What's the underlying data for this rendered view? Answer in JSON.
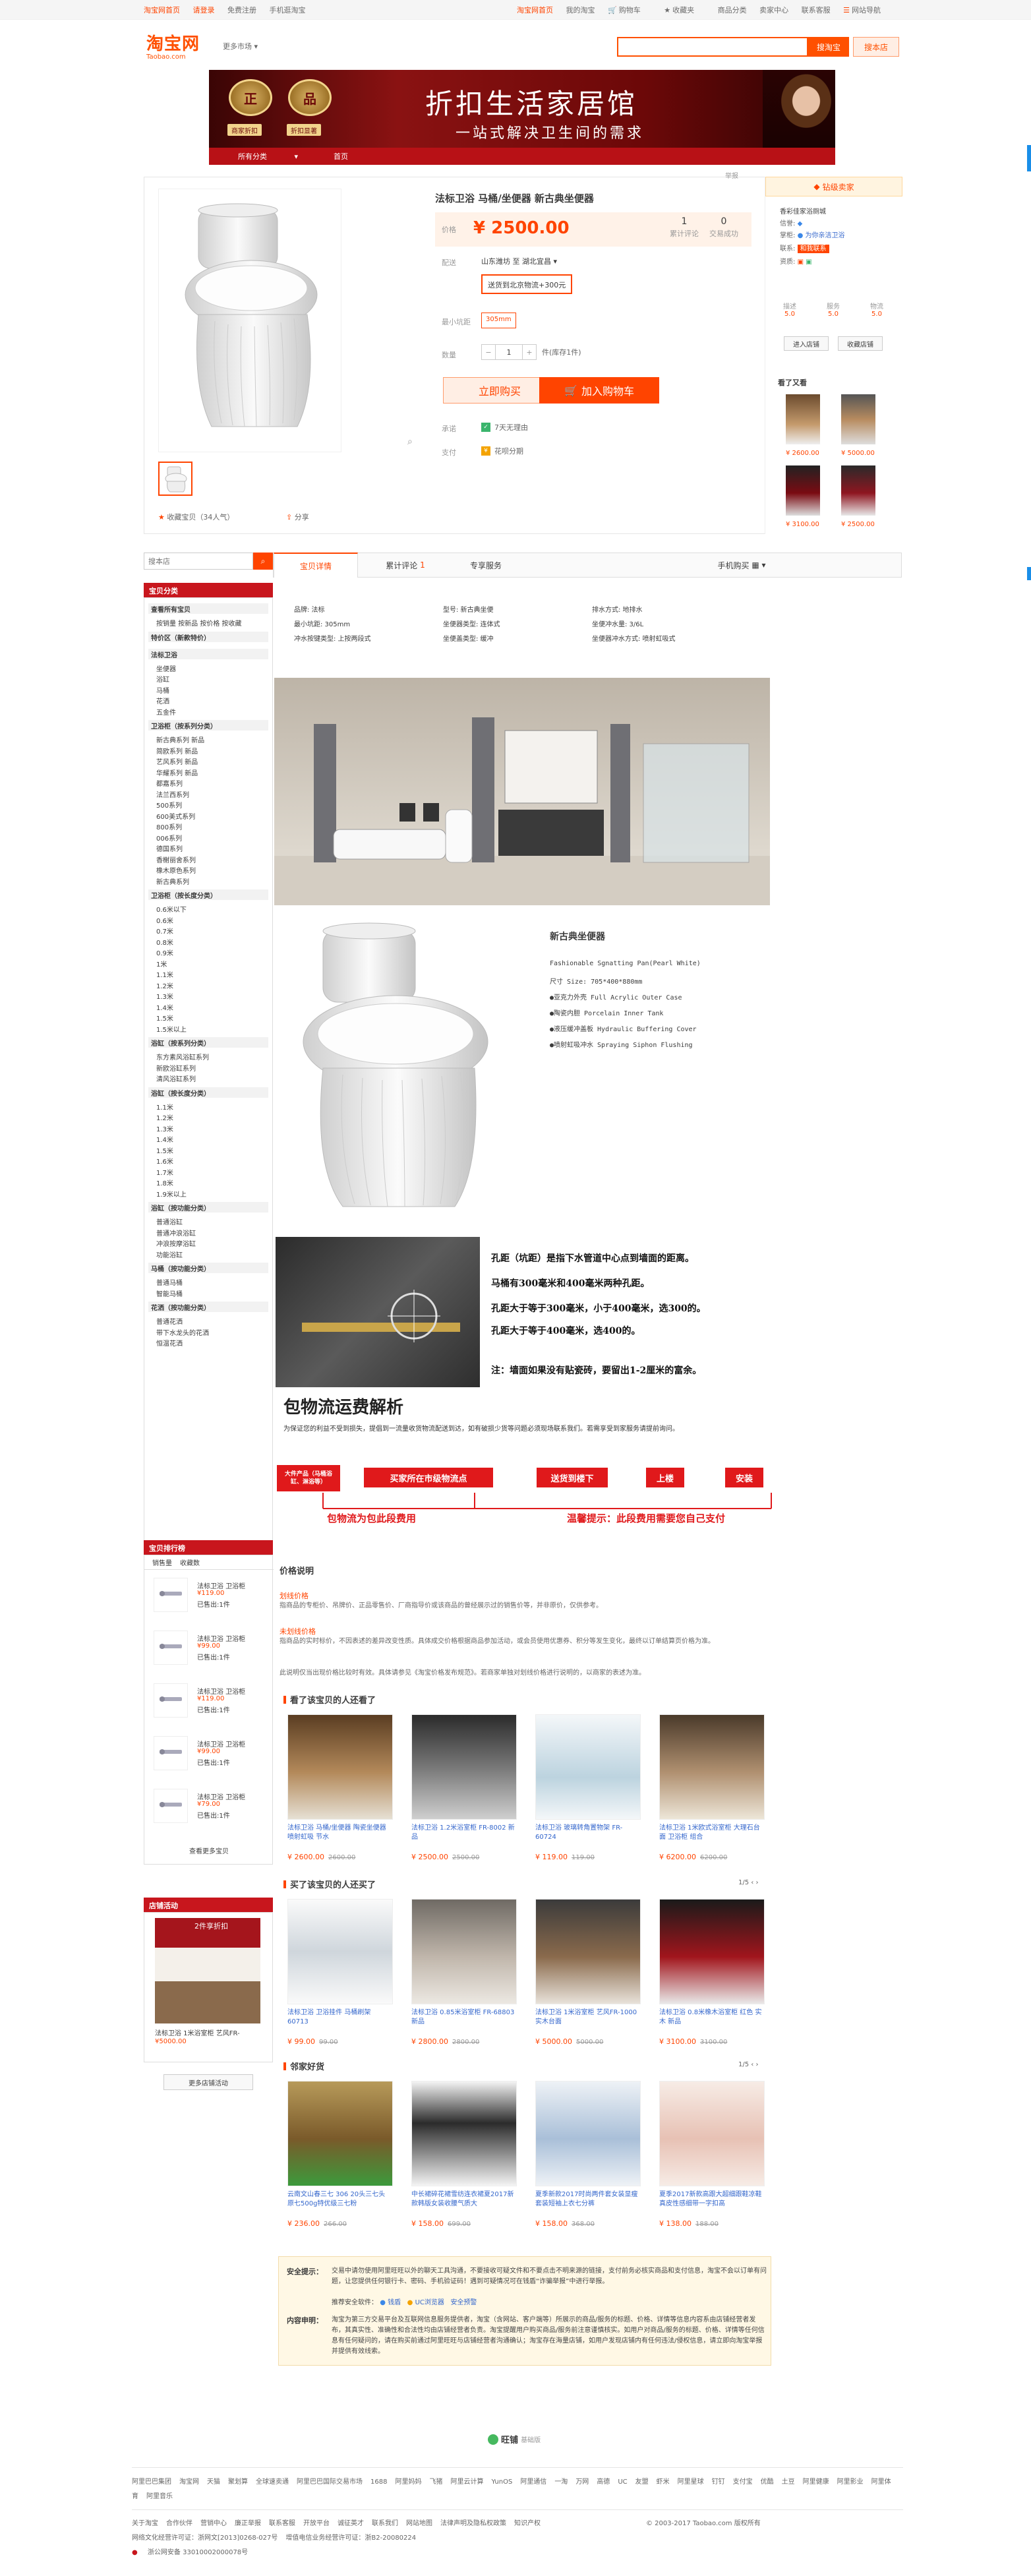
{
  "topnav": {
    "left": [
      "淘宝网首页",
      "请登录",
      "免费注册",
      "手机逛淘宝"
    ],
    "right": [
      "淘宝网首页",
      "我的淘宝",
      "购物车",
      "收藏夹",
      "商品分类",
      "卖家中心",
      "联系客服",
      "网站导航"
    ]
  },
  "header": {
    "logo_cn": "淘宝网",
    "logo_en": "Taobao.com",
    "market": "更多市场",
    "search_placeholder": "",
    "search_taobao": "搜淘宝",
    "search_shop": "搜本店"
  },
  "banner": {
    "title": "折扣生活家居馆",
    "subtitle": "一站式解决卫生间的需求",
    "seal_left": "正",
    "seal_right": "品",
    "mini_left": "商家折扣",
    "mini_right": "折扣显著"
  },
  "shopnav": [
    "所有分类",
    "首页"
  ],
  "product": {
    "title": "法标卫浴 马桶/坐便器 新古典坐便器",
    "price_label": "价格",
    "price": "¥ 2500.00",
    "review_count": "1",
    "review_label": "累计评论",
    "sales_count": "0",
    "sales_label": "交易成功",
    "delivery_label": "配送",
    "delivery_value": "山东潍坊 至 湖北宜昌 ▾",
    "sku_option": "送货到北京物流+300元",
    "size_label": "最小坑距",
    "size_value": "305mm",
    "qty_label": "数量",
    "qty_value": "1",
    "qty_unit": "件(库存1件)",
    "buy_now": "立即购买",
    "add_cart": "加入购物车",
    "promise_label": "承诺",
    "promise_value": "7天无理由",
    "pay_label": "支付",
    "pay_value": "花呗分期",
    "report": "举报",
    "fav_label": "收藏宝贝（34人气）",
    "share_label": "分享"
  },
  "shop": {
    "rank": "钻级卖家",
    "name": "香彩佳家浴厕城",
    "credit_label": "信誉:",
    "owner_label": "掌柜:",
    "owner": "为你亲洁卫浴",
    "contact_label": "联系:",
    "contact_btn": "和我联系",
    "qual_label": "资质:",
    "scores": [
      {
        "label": "描述",
        "value": "5.0"
      },
      {
        "label": "服务",
        "value": "5.0"
      },
      {
        "label": "物流",
        "value": "5.0"
      }
    ],
    "enter": "进入店铺",
    "collect": "收藏店铺",
    "seen_title": "看了又看",
    "seen_prices": [
      "¥ 2600.00",
      "¥ 5000.00",
      "¥ 3100.00",
      "¥ 2500.00"
    ]
  },
  "tabs": [
    "宝贝详情",
    "累计评论",
    "专享服务",
    "手机购买"
  ],
  "tab_review_count": "1",
  "attributes": [
    [
      "品牌: 法标",
      "型号: 新古典坐便",
      "排水方式: 地排水"
    ],
    [
      "最小坑距: 305mm",
      "坐便器类型: 连体式",
      "坐便冲水量: 3/6L"
    ],
    [
      "冲水按键类型: 上按两段式",
      "坐便盖类型: 缓冲",
      "坐便器冲水方式: 喷射虹吸式"
    ]
  ],
  "desc": {
    "name": "新古典坐便器",
    "specs": [
      "Fashionable Sgnatting Pan(Pearl White)",
      "尺寸 Size: 705*400*880mm",
      "●亚克力外壳 Full Acrylic Outer Case",
      "●陶瓷内胆 Porcelain Inner Tank",
      "●液压缓冲盖板 Hydraulic Buffering Cover",
      "●喷射虹吸冲水 Spraying Siphon Flushing"
    ],
    "rough": [
      "孔距（坑距）是指下水管道中心点到墙面的距离。",
      "马桶有300毫米和400毫米两种孔距。",
      "孔距大于等于300毫米，小于400毫米，选300的。",
      "孔距大于等于400毫米，选400的。",
      "注：墙面如果没有贴瓷砖，要留出1-2厘米的富余。"
    ],
    "logistics_title": "包物流运费解析",
    "logistics_note": "为保证您的利益不受到损失，提倡到一流量收货物流配送到达，如有破损少货等问题必须现场联系我们。若需享受到家服务请提前询问。",
    "flow": [
      "大件产品（马桶浴缸、淋浴等）",
      "买家所在市级物流点",
      "送货到楼下",
      "上楼",
      "安装"
    ],
    "flow_bottom_left": "包物流为包此段费用",
    "flow_bottom_right": "温馨提示：此段费用需要您自己支付"
  },
  "sidebar": {
    "search_placeholder": "搜本店",
    "cat_title": "宝贝分类",
    "groups": [
      {
        "h": "查看所有宝贝",
        "items": [
          "按销量  按新品  按价格  按收藏"
        ]
      },
      {
        "h": "特价区（新款特价）",
        "items": []
      },
      {
        "h": "法标卫浴",
        "items": [
          "坐便器",
          "浴缸",
          "马桶",
          "花洒",
          "五金件"
        ]
      },
      {
        "h": "卫浴柜（按系列分类）",
        "items": [
          "新古典系列 新品",
          "简欧系列 新品",
          "艺风系列 新品",
          "华耀系列 新品",
          "都嘉系列",
          "法兰西系列",
          "500系列",
          "600美式系列",
          "800系列",
          "006系列",
          "德国系列",
          "香榭丽舍系列",
          "橡木原色系列",
          "新古典系列"
        ]
      },
      {
        "h": "卫浴柜（按长度分类）",
        "items": [
          "0.6米以下",
          "0.6米",
          "0.7米",
          "0.8米",
          "0.9米",
          "1米",
          "1.1米",
          "1.2米",
          "1.3米",
          "1.4米",
          "1.5米",
          "1.5米以上"
        ]
      },
      {
        "h": "浴缸（按系列分类）",
        "items": [
          "东方素风浴缸系列",
          "新欧浴缸系列",
          "清风浴缸系列"
        ]
      },
      {
        "h": "浴缸（按长度分类）",
        "items": [
          "1.1米",
          "1.2米",
          "1.3米",
          "1.4米",
          "1.5米",
          "1.6米",
          "1.7米",
          "1.8米",
          "1.9米以上"
        ]
      },
      {
        "h": "浴缸（按功能分类）",
        "items": [
          "普通浴缸",
          "普通冲浪浴缸",
          "冲浪按摩浴缸",
          "功能浴缸"
        ]
      },
      {
        "h": "马桶（按功能分类）",
        "items": [
          "普通马桶",
          "智能马桶"
        ]
      },
      {
        "h": "花洒（按功能分类）",
        "items": [
          "普通花洒",
          "带下水龙头的花洒",
          "恒温花洒"
        ]
      }
    ],
    "rank_title": "宝贝排行榜",
    "rank_tabs": [
      "销售量",
      "收藏数"
    ],
    "rank_items": [
      {
        "title": "法标卫浴  卫浴柜",
        "price": "¥119.00",
        "sold": "已售出:1件"
      },
      {
        "title": "法标卫浴  卫浴柜",
        "price": "¥99.00",
        "sold": "已售出:1件"
      },
      {
        "title": "法标卫浴  卫浴柜",
        "price": "¥119.00",
        "sold": "已售出:1件"
      },
      {
        "title": "法标卫浴  卫浴柜",
        "price": "¥99.00",
        "sold": "已售出:1件"
      },
      {
        "title": "法标卫浴  卫浴柜",
        "price": "¥79.00",
        "sold": "已售出:1件"
      }
    ],
    "rank_more": "查看更多宝贝",
    "promo_title": "店铺活动",
    "promo_badge": "2件享折扣",
    "promo_item": "法标卫浴 1米浴室柜 艺风FR-",
    "promo_price": "¥5000.00",
    "promo_more": "更多店铺活动"
  },
  "price_note": {
    "title": "价格说明",
    "h1": "划线价格",
    "t1": "指商品的专柜价、吊牌价、正品零售价、厂商指导价或该商品的曾经展示过的销售价等，并非原价，仅供参考。",
    "h2": "未划线价格",
    "t2": "指商品的实时标价，不因表述的差异改变性质。具体成交价格根据商品参加活动，或会员使用优惠券、积分等发生变化，最终以订单结算页价格为准。",
    "t3": "此说明仅当出现价格比较时有效。具体请参见《淘宝价格发布规范》。若商家单独对划线价格进行说明的，以商家的表述为准。"
  },
  "also_viewed": {
    "title": "看了该宝贝的人还看了",
    "items": [
      {
        "title": "法标卫浴 马桶/坐便器 陶瓷坐便器 喷射虹吸 节水",
        "price": "¥ 2600.00",
        "old": "2600.00"
      },
      {
        "title": "法标卫浴 1.2米浴室柜 FR-8002 新品",
        "price": "¥ 2500.00",
        "old": "2500.00"
      },
      {
        "title": "法标卫浴 玻璃转角置物架 FR-60724",
        "price": "¥ 119.00",
        "old": "119.00"
      },
      {
        "title": "法标卫浴 1米欧式浴室柜 大理石台面 卫浴柜 组合",
        "price": "¥ 6200.00",
        "old": "6200.00"
      }
    ]
  },
  "also_bought": {
    "title": "买了该宝贝的人还买了",
    "page": "1/5",
    "items": [
      {
        "title": "法标卫浴 卫浴挂件 马桶刷架 60713",
        "price": "¥ 99.00",
        "old": "99.00"
      },
      {
        "title": "法标卫浴 0.85米浴室柜 FR-68803 新品",
        "price": "¥ 2800.00",
        "old": "2800.00"
      },
      {
        "title": "法标卫浴 1米浴室柜 艺风FR-1000 实木台面",
        "price": "¥ 5000.00",
        "old": "5000.00"
      },
      {
        "title": "法标卫浴 0.8米橡木浴室柜 红色 实木 新品",
        "price": "¥ 3100.00",
        "old": "3100.00"
      }
    ]
  },
  "neighbors": {
    "title": "邻家好货",
    "page": "1/5",
    "items": [
      {
        "title": "云南文山春三七 306 20头三七头 原七500g特优级三七粉",
        "price": "¥ 236.00",
        "old": "266.00"
      },
      {
        "title": "中长裙碎花裙雪纺连衣裙夏2017新款韩版女装收腰气质大",
        "price": "¥ 158.00",
        "old": "699.00"
      },
      {
        "title": "夏季新款2017时尚两件套女装显瘦套装短袖上衣七分裤",
        "price": "¥ 158.00",
        "old": "368.00"
      },
      {
        "title": "夏季2017新款高跟大超细跟鞋凉鞋真皮性感细带一字扣高",
        "price": "¥ 138.00",
        "old": "188.00"
      }
    ]
  },
  "notice": {
    "h1": "安全提示：",
    "t1": "交易中请勿使用阿里旺旺以外的聊天工具沟通，不要接收可疑文件和不要点击不明来源的链接，支付前务必核实商品和支付信息，淘宝不会以订单有问题，让您提供任何银行卡、密码、手机验证码！遇到可疑情况可在钱盾“诈骗举报”中进行举报。",
    "t1b": "安全预警",
    "t1c": "推荐安全软件：",
    "sw1": "钱盾",
    "sw2": "UC浏览器",
    "h2": "内容申明：",
    "t2": "淘宝为第三方交易平台及互联网信息服务提供者，淘宝（含网站、客户端等）所展示的商品/服务的标题、价格、详情等信息内容系由店铺经营者发布，其真实性、准确性和合法性均由店铺经营者负责。淘宝提醒用户购买商品/服务前注意谨慎核实。如用户对商品/服务的标题、价格、详情等任何信息有任何疑问的，请在购买前通过阿里旺旺与店铺经营者沟通确认；淘宝存在海量店铺，如用户发现店铺内有任何违法/侵权信息，请立即向淘宝举报并提供有效线索。"
  },
  "wangpu": "旺铺",
  "wangpu_sub": "基础版",
  "footer": {
    "links": [
      "阿里巴巴集团",
      "淘宝网",
      "天猫",
      "聚划算",
      "全球速卖通",
      "阿里巴巴国际交易市场",
      "1688",
      "阿里妈妈",
      "飞猪",
      "阿里云计算",
      "YunOS",
      "阿里通信",
      "一淘",
      "万网",
      "高德",
      "UC",
      "友盟",
      "虾米",
      "阿里星球",
      "钉钉",
      "支付宝",
      "优酷",
      "土豆",
      "阿里健康",
      "阿里影业",
      "阿里体育",
      "阿里音乐"
    ],
    "about": [
      "关于淘宝",
      "合作伙伴",
      "营销中心",
      "廉正举报",
      "联系客服",
      "开放平台",
      "诚征英才",
      "联系我们",
      "网站地图",
      "法律声明及隐私权政策",
      "知识产权"
    ],
    "copyright": "© 2003-2017 Taobao.com 版权所有",
    "lic1": "网络文化经营许可证：浙网文[2013]0268-027号",
    "lic2": "增值电信业务经营许可证：浙B2-20080224",
    "lic3": "浙公网安备 33010002000078号"
  }
}
